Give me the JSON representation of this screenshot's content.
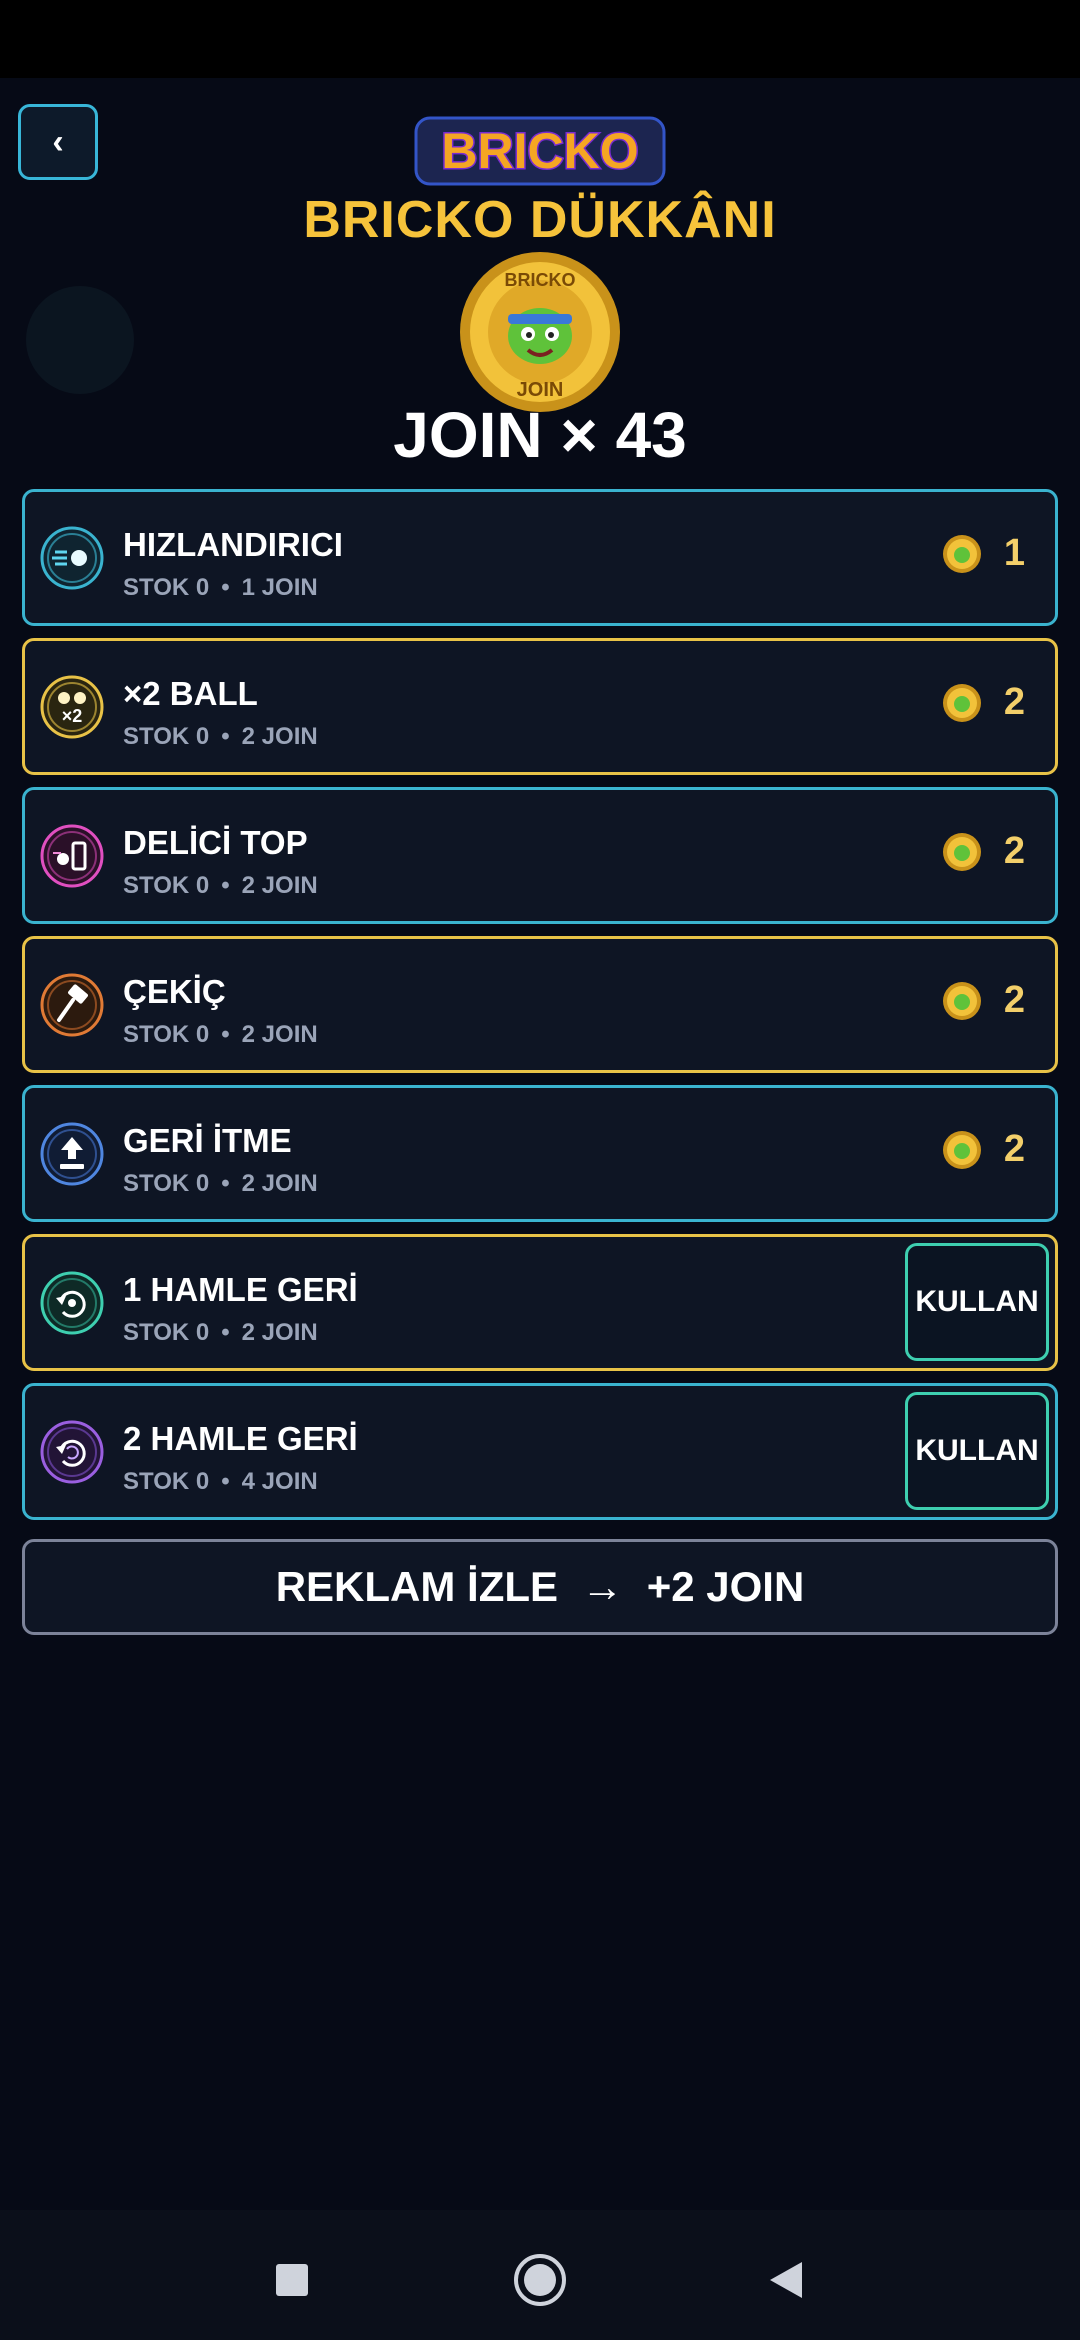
{
  "header": {
    "back_label": "‹",
    "logo_text": "BRICKO",
    "title": "BRICKO DÜKKÂNI",
    "coin_top_text": "BRICKO",
    "coin_bottom_text": "JOIN",
    "balance": "JOIN × 43"
  },
  "items": [
    {
      "name": "HIZLANDIRICI",
      "stock": "STOK 0",
      "cost": "1 JOIN",
      "price": "1",
      "icon": "speed-boost-icon",
      "border_color": "#3ab3cf"
    },
    {
      "name": "×2 BALL",
      "stock": "STOK 0",
      "cost": "2 JOIN",
      "price": "2",
      "icon": "double-ball-icon",
      "border_color": "#e8c247"
    },
    {
      "name": "DELİCİ TOP",
      "stock": "STOK 0",
      "cost": "2 JOIN",
      "price": "2",
      "icon": "piercing-ball-icon",
      "border_color": "#3ab3cf"
    },
    {
      "name": "ÇEKİÇ",
      "stock": "STOK 0",
      "cost": "2 JOIN",
      "price": "2",
      "icon": "hammer-icon",
      "border_color": "#e8c247"
    },
    {
      "name": "GERİ İTME",
      "stock": "STOK 0",
      "cost": "2 JOIN",
      "price": "2",
      "icon": "push-back-icon",
      "border_color": "#3ab3cf"
    },
    {
      "name": "1 HAMLE GERİ",
      "stock": "STOK 0",
      "cost": "2 JOIN",
      "action": "KULLAN",
      "icon": "undo-one-icon",
      "border_color": "#e8c247"
    },
    {
      "name": "2 HAMLE GERİ",
      "stock": "STOK 0",
      "cost": "4 JOIN",
      "action": "KULLAN",
      "icon": "undo-two-icon",
      "border_color": "#3ab3cf"
    }
  ],
  "watch_ad": {
    "label": "REKLAM İZLE  →  +2 JOIN"
  },
  "colors": {
    "background": "#060a16",
    "title_gold": "#f6c33b",
    "price_gold": "#f3cf6a",
    "cyan_border": "#3ab3cf",
    "gold_border": "#e8c247",
    "use_button_border": "#3ecfb0"
  }
}
